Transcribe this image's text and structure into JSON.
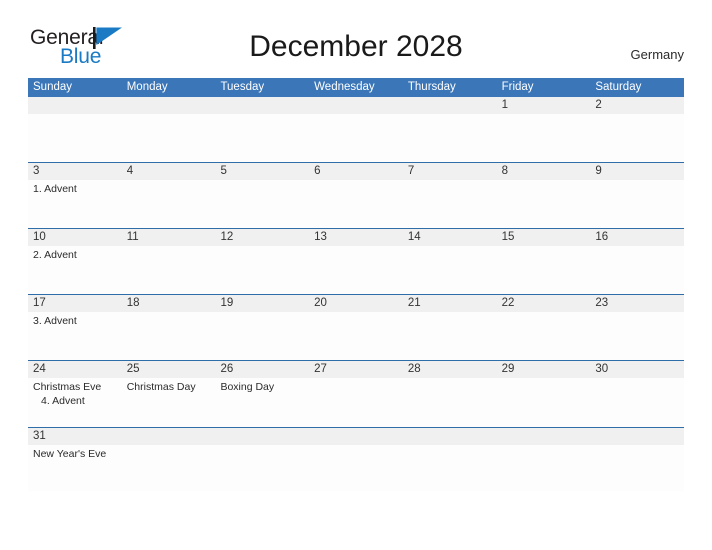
{
  "brand": {
    "name_part1": "General",
    "name_part2": "Blue",
    "flag_icon": "blue-flag-triangle-icon",
    "color_dark": "#231f20",
    "color_blue": "#1a7bc4"
  },
  "header": {
    "title": "December 2028",
    "country": "Germany"
  },
  "theme": {
    "header_blue": "#3a76b8",
    "rule_blue": "#2e6da8",
    "date_band_grey": "#f0f0f0",
    "cell_white": "#fdfdfd"
  },
  "calendar": {
    "weekdays": [
      "Sunday",
      "Monday",
      "Tuesday",
      "Wednesday",
      "Thursday",
      "Friday",
      "Saturday"
    ],
    "weeks": [
      {
        "days": [
          {
            "date": "",
            "events": []
          },
          {
            "date": "",
            "events": []
          },
          {
            "date": "",
            "events": []
          },
          {
            "date": "",
            "events": []
          },
          {
            "date": "",
            "events": []
          },
          {
            "date": "1",
            "events": []
          },
          {
            "date": "2",
            "events": []
          }
        ]
      },
      {
        "days": [
          {
            "date": "3",
            "events": [
              "1. Advent"
            ]
          },
          {
            "date": "4",
            "events": []
          },
          {
            "date": "5",
            "events": []
          },
          {
            "date": "6",
            "events": []
          },
          {
            "date": "7",
            "events": []
          },
          {
            "date": "8",
            "events": []
          },
          {
            "date": "9",
            "events": []
          }
        ]
      },
      {
        "days": [
          {
            "date": "10",
            "events": [
              "2. Advent"
            ]
          },
          {
            "date": "11",
            "events": []
          },
          {
            "date": "12",
            "events": []
          },
          {
            "date": "13",
            "events": []
          },
          {
            "date": "14",
            "events": []
          },
          {
            "date": "15",
            "events": []
          },
          {
            "date": "16",
            "events": []
          }
        ]
      },
      {
        "days": [
          {
            "date": "17",
            "events": [
              "3. Advent"
            ]
          },
          {
            "date": "18",
            "events": []
          },
          {
            "date": "19",
            "events": []
          },
          {
            "date": "20",
            "events": []
          },
          {
            "date": "21",
            "events": []
          },
          {
            "date": "22",
            "events": []
          },
          {
            "date": "23",
            "events": []
          }
        ]
      },
      {
        "days": [
          {
            "date": "24",
            "events": [
              "Christmas Eve",
              "4. Advent"
            ]
          },
          {
            "date": "25",
            "events": [
              "Christmas Day"
            ]
          },
          {
            "date": "26",
            "events": [
              "Boxing Day"
            ]
          },
          {
            "date": "27",
            "events": []
          },
          {
            "date": "28",
            "events": []
          },
          {
            "date": "29",
            "events": []
          },
          {
            "date": "30",
            "events": []
          }
        ]
      },
      {
        "days": [
          {
            "date": "31",
            "events": [
              "New Year's Eve"
            ]
          },
          {
            "date": "",
            "events": []
          },
          {
            "date": "",
            "events": []
          },
          {
            "date": "",
            "events": []
          },
          {
            "date": "",
            "events": []
          },
          {
            "date": "",
            "events": []
          },
          {
            "date": "",
            "events": []
          }
        ]
      }
    ]
  }
}
